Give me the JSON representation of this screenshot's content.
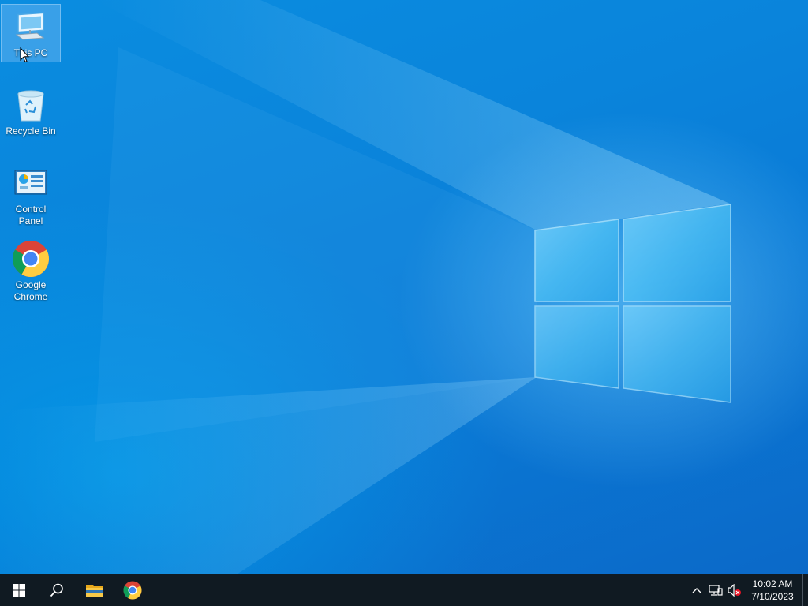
{
  "desktop": {
    "icons": [
      {
        "label": "This PC",
        "icon": "this-pc-icon"
      },
      {
        "label": "Recycle Bin",
        "icon": "recycle-bin-icon"
      },
      {
        "label": "Control Panel",
        "icon": "control-panel-icon"
      },
      {
        "label": "Google Chrome",
        "icon": "chrome-icon"
      }
    ]
  },
  "taskbar": {
    "buttons": [
      "start-icon",
      "search-icon",
      "file-explorer-icon",
      "chrome-icon"
    ],
    "tray": {
      "icons": [
        "chevron-up-icon",
        "network-icon",
        "volume-muted-icon"
      ],
      "time": "10:02 AM",
      "date": "7/10/2023"
    }
  },
  "colors": {
    "desktop_blue": "#0a84db",
    "taskbar": "#101a22"
  }
}
